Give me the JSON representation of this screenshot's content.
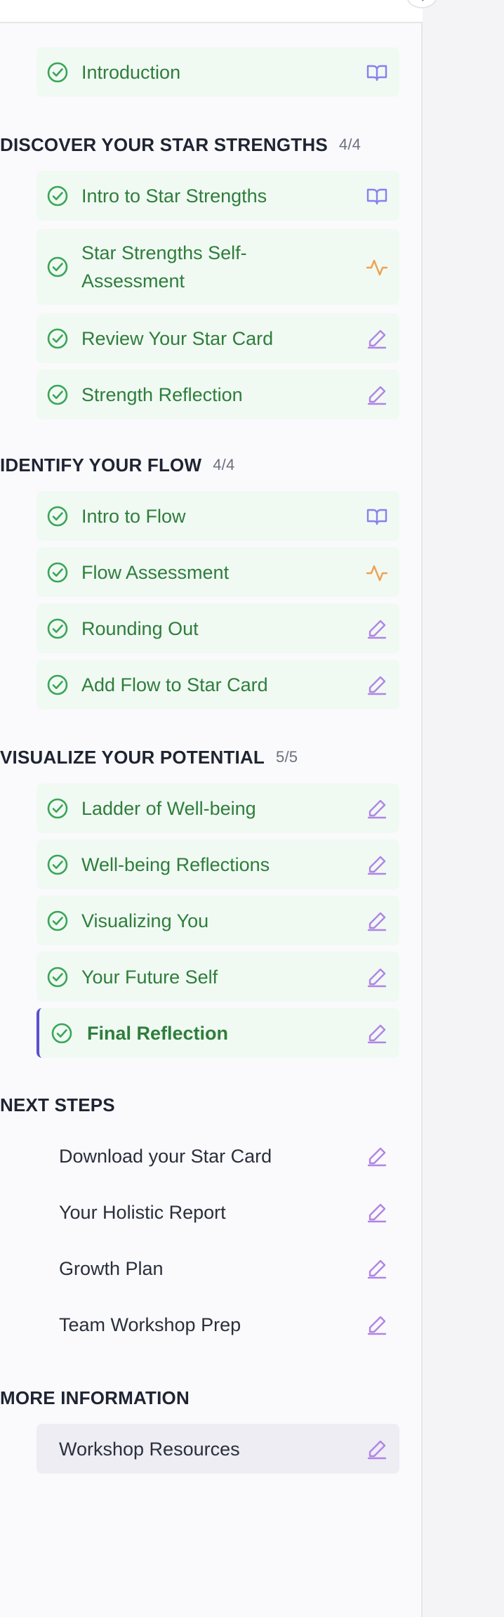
{
  "sections": [
    {
      "title": "",
      "count": "",
      "items": [
        {
          "label": "Introduction",
          "status": "complete",
          "icon": "book-icon"
        }
      ]
    },
    {
      "title": "DISCOVER YOUR STAR STRENGTHS",
      "count": "4/4",
      "items": [
        {
          "label": "Intro to Star Strengths",
          "status": "complete",
          "icon": "book-icon"
        },
        {
          "label": "Star Strengths Self-Assessment",
          "status": "complete",
          "icon": "activity-icon"
        },
        {
          "label": "Review Your Star Card",
          "status": "complete",
          "icon": "pencil-icon"
        },
        {
          "label": "Strength Reflection",
          "status": "complete",
          "icon": "pencil-icon"
        }
      ]
    },
    {
      "title": "IDENTIFY YOUR FLOW",
      "count": "4/4",
      "items": [
        {
          "label": "Intro to Flow",
          "status": "complete",
          "icon": "book-icon"
        },
        {
          "label": "Flow Assessment",
          "status": "complete",
          "icon": "activity-icon"
        },
        {
          "label": "Rounding Out",
          "status": "complete",
          "icon": "pencil-icon"
        },
        {
          "label": "Add Flow to Star Card",
          "status": "complete",
          "icon": "pencil-icon"
        }
      ]
    },
    {
      "title": "VISUALIZE YOUR POTENTIAL",
      "count": "5/5",
      "items": [
        {
          "label": "Ladder of Well-being",
          "status": "complete",
          "icon": "pencil-icon"
        },
        {
          "label": "Well-being Reflections",
          "status": "complete",
          "icon": "pencil-icon"
        },
        {
          "label": "Visualizing You",
          "status": "complete",
          "icon": "pencil-icon"
        },
        {
          "label": "Your Future Self",
          "status": "complete",
          "icon": "pencil-icon"
        },
        {
          "label": "Final Reflection",
          "status": "active",
          "icon": "pencil-icon"
        }
      ]
    },
    {
      "title": "NEXT STEPS",
      "count": "",
      "items": [
        {
          "label": "Download your Star Card",
          "status": "none",
          "icon": "pencil-icon"
        },
        {
          "label": "Your Holistic Report",
          "status": "none",
          "icon": "pencil-icon"
        },
        {
          "label": "Growth Plan",
          "status": "none",
          "icon": "pencil-icon"
        },
        {
          "label": "Team Workshop Prep",
          "status": "none",
          "icon": "pencil-icon"
        }
      ]
    },
    {
      "title": "MORE INFORMATION",
      "count": "",
      "items": [
        {
          "label": "Workshop Resources",
          "status": "resource",
          "icon": "pencil-icon"
        }
      ]
    }
  ],
  "colors": {
    "complete_text": "#2f7d3b",
    "complete_bg": "#f0faf3",
    "active_border": "#5b4fd1",
    "book_icon": "#8a7ff0",
    "activity_icon": "#f0a050",
    "pencil_icon": "#b184e6",
    "check_icon": "#3aa557"
  }
}
